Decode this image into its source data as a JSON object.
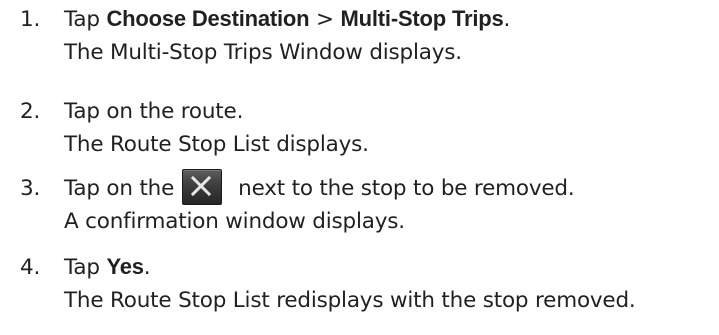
{
  "steps": [
    {
      "number": "1.",
      "pre": "Tap ",
      "term1": "Choose Destination",
      "sep": " > ",
      "term2": "Multi-Stop Trips",
      "post": ".",
      "result": "The Multi-Stop Trips Window displays."
    },
    {
      "number": "2.",
      "text": "Tap on the route.",
      "result": "The Route Stop List displays."
    },
    {
      "number": "3.",
      "pre": "Tap on the",
      "post": "next to the stop to be removed.",
      "icon": "close-icon",
      "result": "A confirmation window displays."
    },
    {
      "number": "4.",
      "pre": "Tap ",
      "term": "Yes",
      "post": ".",
      "result": "The Route Stop List redisplays with the stop removed."
    }
  ]
}
